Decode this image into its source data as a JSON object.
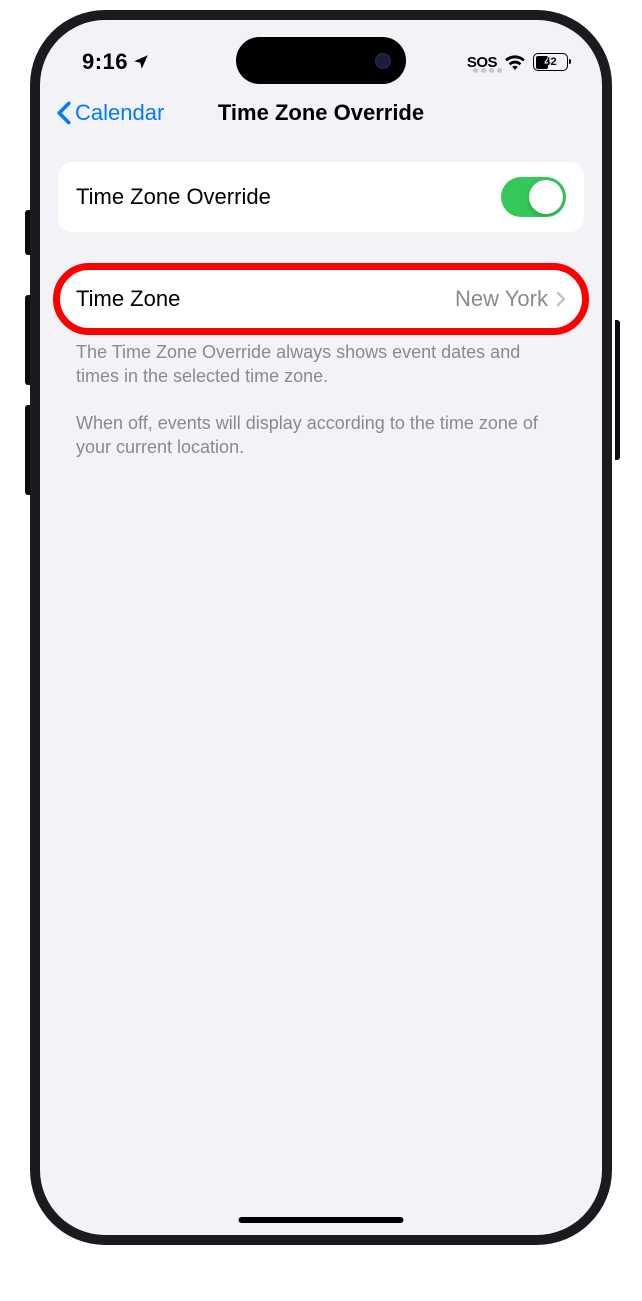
{
  "status": {
    "time": "9:16",
    "sos": "SOS",
    "battery_percent": "42"
  },
  "nav": {
    "back_label": "Calendar",
    "title": "Time Zone Override"
  },
  "settings": {
    "override_toggle_label": "Time Zone Override",
    "timezone_label": "Time Zone",
    "timezone_value": "New York"
  },
  "footer": {
    "p1": "The Time Zone Override always shows event dates and times in the selected time zone.",
    "p2": "When off, events will display according to the time zone of your current location."
  }
}
